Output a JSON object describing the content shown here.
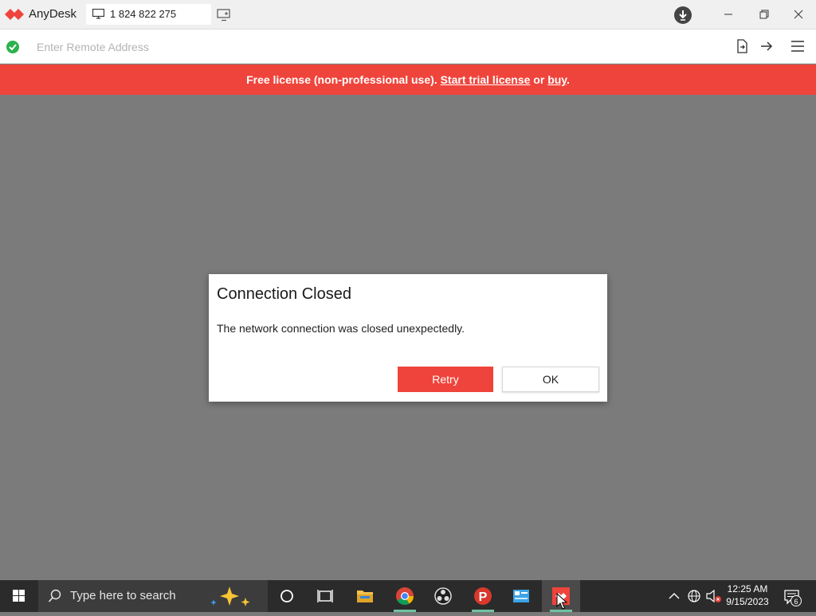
{
  "app": {
    "name": "AnyDesk",
    "tab_label": "1 824 822 275"
  },
  "addressbar": {
    "placeholder": "Enter Remote Address"
  },
  "banner": {
    "text_prefix": "Free license (non-professional use). ",
    "trial_link": "Start trial license",
    "or_text": " or ",
    "buy_link": "buy",
    "suffix": ".",
    "color": "#ef443b"
  },
  "dialog": {
    "title": "Connection Closed",
    "message": "The network connection was closed unexpectedly.",
    "retry_label": "Retry",
    "ok_label": "OK"
  },
  "taskbar": {
    "search_placeholder": "Type here to search",
    "time": "12:25 AM",
    "date": "9/15/2023",
    "notification_count": "6",
    "icons": [
      "windows-start-icon",
      "cortana-icon",
      "task-view-icon",
      "file-explorer-icon",
      "chrome-icon",
      "obs-icon",
      "psiphon-icon",
      "control-panel-icon",
      "anydesk-icon"
    ]
  },
  "colors": {
    "accent": "#ef443b",
    "status_ok": "#2bb24c"
  }
}
